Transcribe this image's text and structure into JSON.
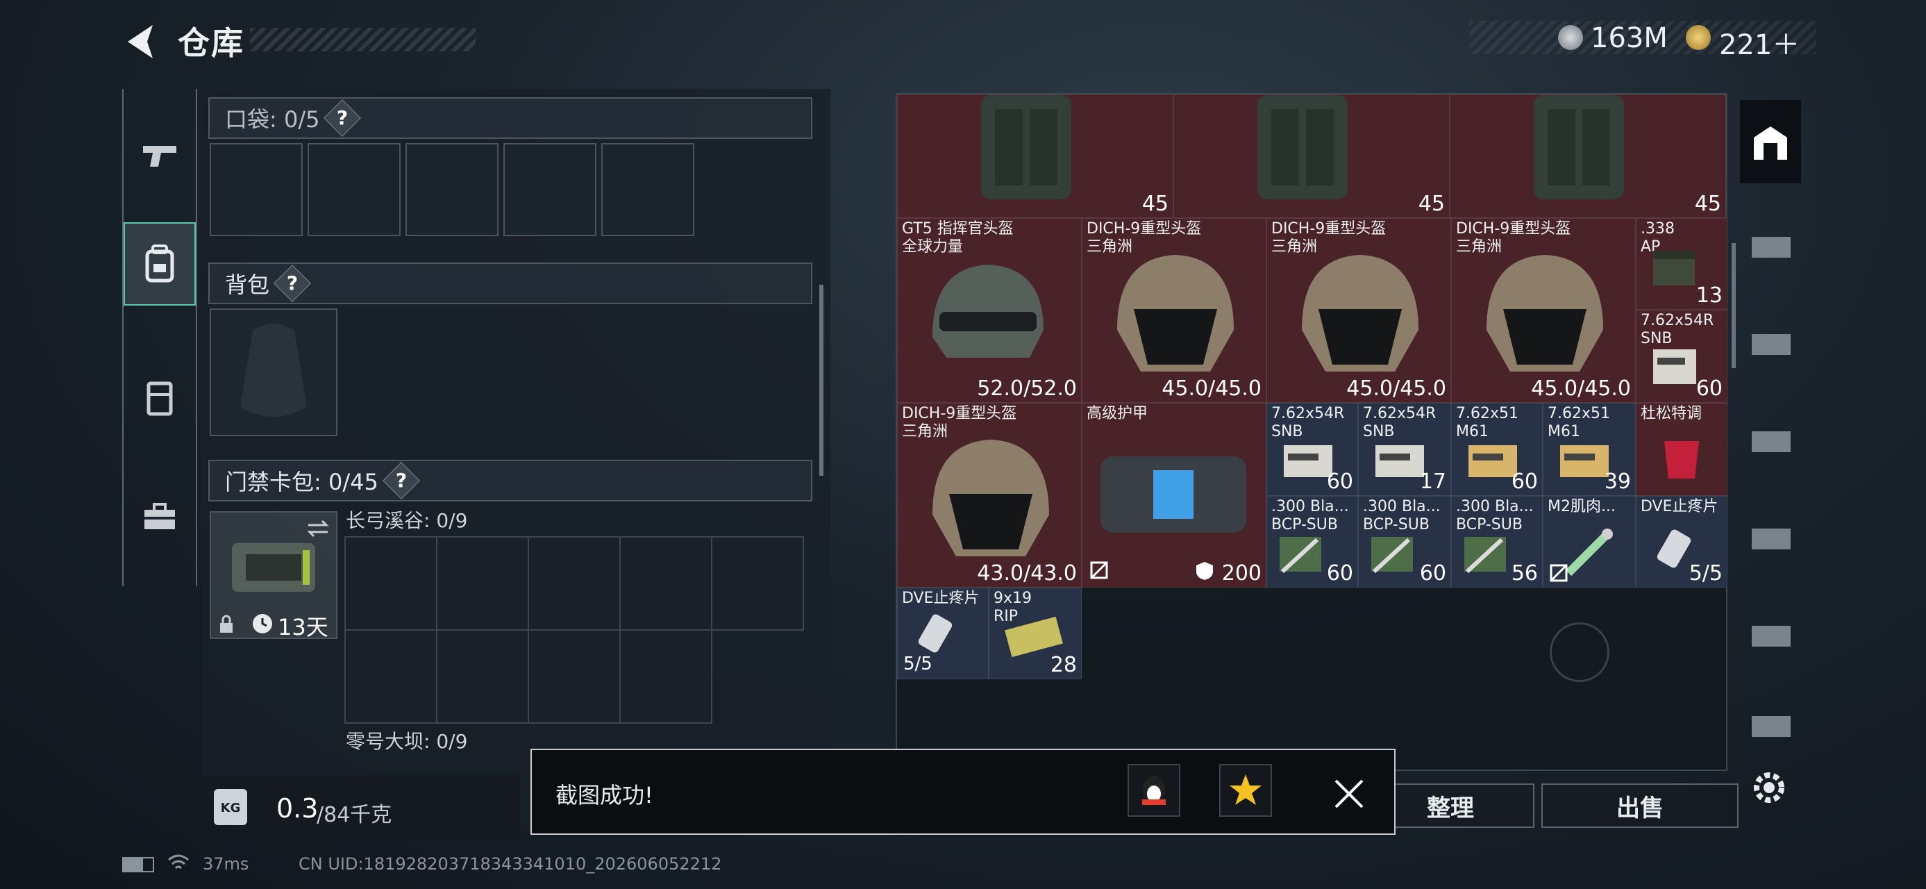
{
  "header": {
    "title": "仓库"
  },
  "currency": {
    "silver": "163M",
    "gold": "221＋"
  },
  "sections": {
    "pocket": {
      "label": "口袋: 0/5",
      "help": "?"
    },
    "backpack": {
      "label": "背包",
      "help": "?"
    },
    "keycase": {
      "label": "门禁卡包: 0/45",
      "help": "?",
      "days": "13天"
    },
    "map1": "长弓溪谷: 0/9",
    "map2": "零号大坝: 0/9"
  },
  "weight": {
    "value": "0.3",
    "max": "/84千克"
  },
  "grid": {
    "row0": [
      {
        "value": "45"
      },
      {
        "value": "45"
      },
      {
        "value": "45"
      }
    ],
    "items": [
      {
        "name": "GT5 指挥官头盔\n全球力量",
        "value": "52.0/52.0"
      },
      {
        "name": "DICH-9重型头盔\n三角洲",
        "value": "45.0/45.0"
      },
      {
        "name": "DICH-9重型头盔\n三角洲",
        "value": "45.0/45.0"
      },
      {
        "name": "DICH-9重型头盔\n三角洲",
        "value": "45.0/45.0"
      },
      {
        "name": ".338\nAP",
        "value": "13"
      },
      {
        "name": "7.62x54R\nSNB",
        "value": "60"
      },
      {
        "name": "DICH-9重型头盔\n三角洲",
        "value": "43.0/43.0"
      },
      {
        "name": "高级护甲",
        "value": "200"
      },
      {
        "name": "7.62x54R\nSNB",
        "value": "60"
      },
      {
        "name": "7.62x54R\nSNB",
        "value": "17"
      },
      {
        "name": "7.62x51\nM61",
        "value": "60"
      },
      {
        "name": "7.62x51\nM61",
        "value": "39"
      },
      {
        "name": "杜松特调",
        "value": ""
      },
      {
        "name": ".300 Bla...\nBCP-SUB",
        "value": "60"
      },
      {
        "name": ".300 Bla...\nBCP-SUB",
        "value": "60"
      },
      {
        "name": ".300 Bla...\nBCP-SUB",
        "value": "56"
      },
      {
        "name": "M2肌肉...",
        "value": ""
      },
      {
        "name": "DVE止疼片",
        "value": "5/5"
      },
      {
        "name": "DVE止疼片",
        "value": "5/5"
      },
      {
        "name": "9x19\nRIP",
        "value": "28"
      }
    ]
  },
  "buttons": {
    "sort": "整理",
    "sell": "出售"
  },
  "toast": {
    "text": "截图成功!"
  },
  "status": {
    "ping": "37ms",
    "uid": "CN UID:18192820371834334101​0_202606052212"
  }
}
